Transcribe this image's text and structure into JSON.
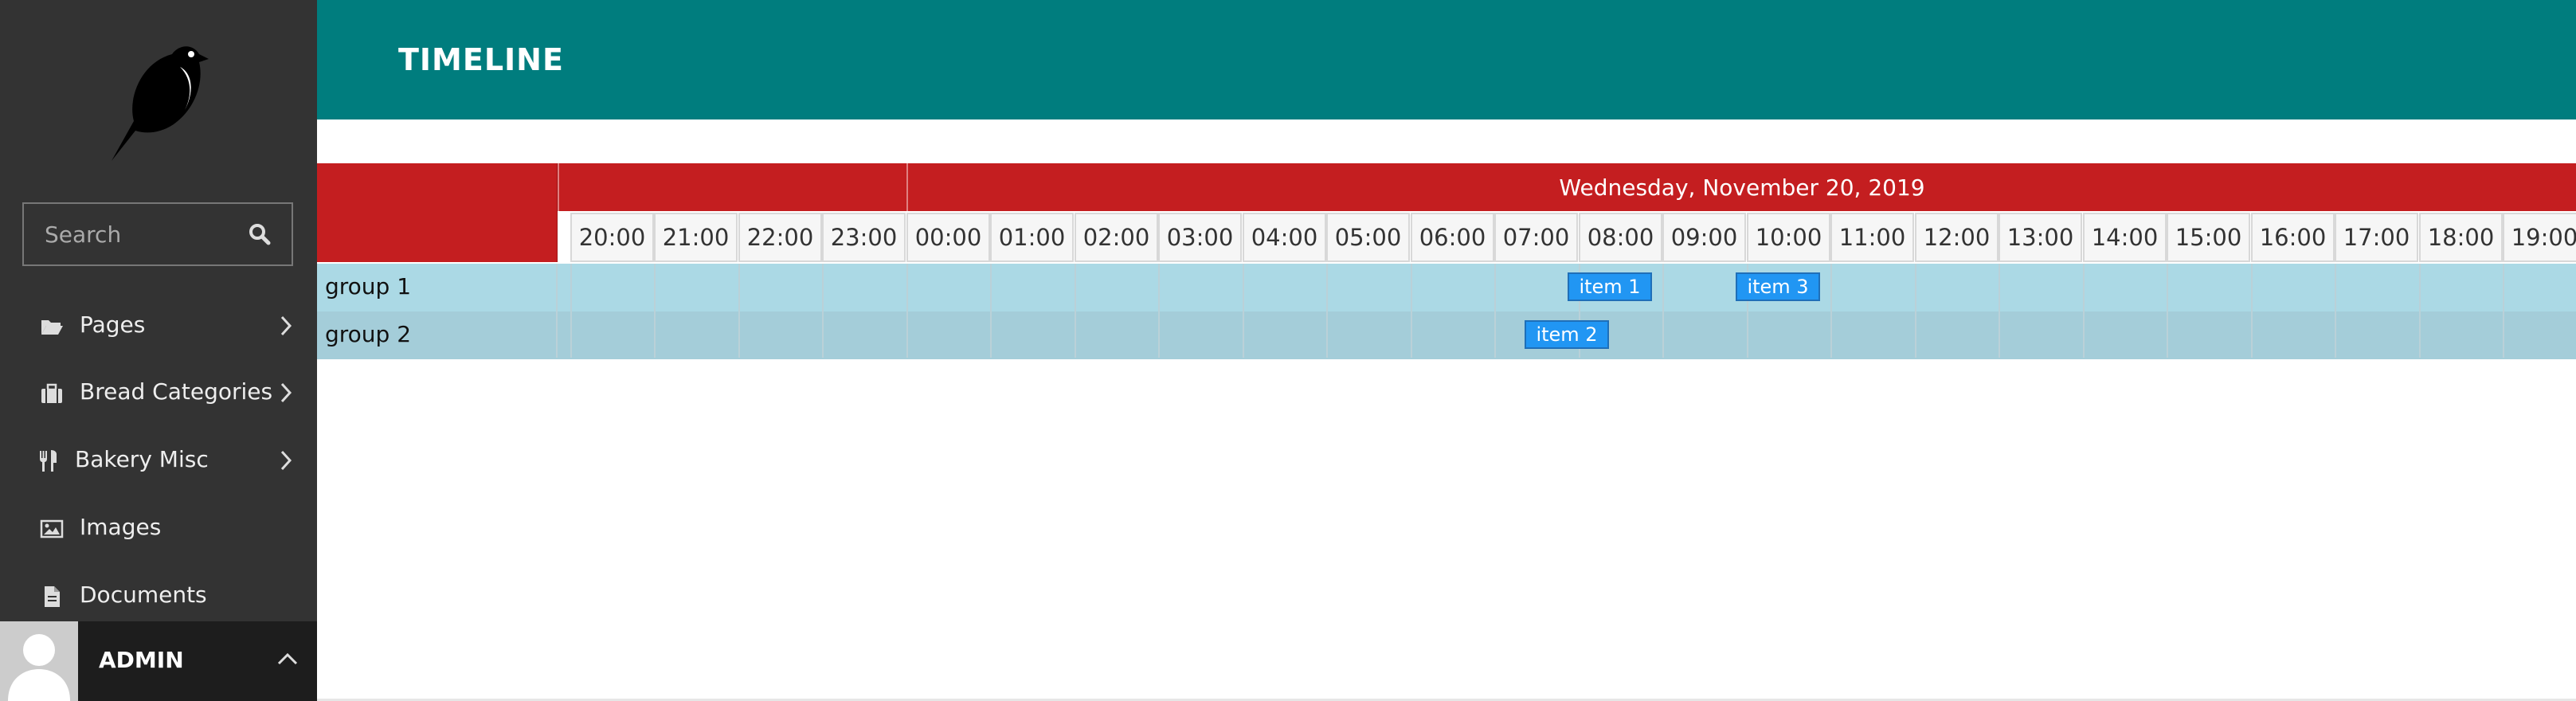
{
  "sidebar": {
    "search": {
      "placeholder": "Search"
    },
    "items": [
      {
        "label": "Pages",
        "icon": "folder-open-icon",
        "has_submenu": true
      },
      {
        "label": "Bread Categories",
        "icon": "suitcase-icon",
        "has_submenu": true
      },
      {
        "label": "Bakery Misc",
        "icon": "utensils-icon",
        "has_submenu": true
      },
      {
        "label": "Images",
        "icon": "image-icon",
        "has_submenu": false
      },
      {
        "label": "Documents",
        "icon": "document-icon",
        "has_submenu": false
      }
    ],
    "account": {
      "name": "ADMIN"
    }
  },
  "header": {
    "title": "TIMELINE"
  },
  "timeline": {
    "date_label": "Wednesday, November 20, 2019",
    "hours": [
      "20:00",
      "21:00",
      "22:00",
      "23:00",
      "00:00",
      "01:00",
      "02:00",
      "03:00",
      "04:00",
      "05:00",
      "06:00",
      "07:00",
      "08:00",
      "09:00",
      "10:00",
      "11:00",
      "12:00",
      "13:00",
      "14:00",
      "15:00",
      "16:00",
      "17:00",
      "18:00",
      "19:00"
    ],
    "groups": [
      {
        "label": "group 1"
      },
      {
        "label": "group 2"
      }
    ],
    "items": [
      {
        "label": "item 1",
        "group": "group 1"
      },
      {
        "label": "item 3",
        "group": "group 1"
      },
      {
        "label": "item 2",
        "group": "group 2"
      }
    ]
  },
  "colors": {
    "header_bg": "#007d7e",
    "sidebar_bg": "#333333",
    "timeline_header": "#c41e20",
    "item": "#2196f3",
    "row_bg": "#abd9e5"
  }
}
